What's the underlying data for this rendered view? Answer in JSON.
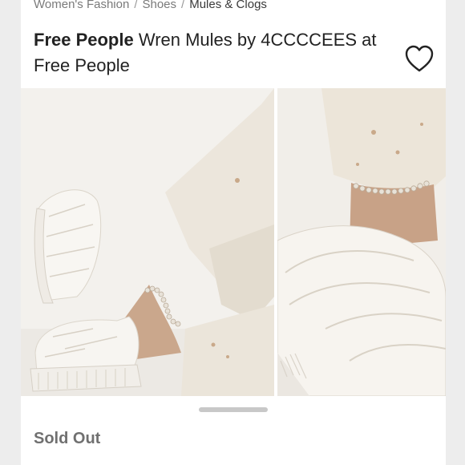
{
  "breadcrumb": {
    "items": [
      {
        "label": "Women's Fashion"
      },
      {
        "label": "Shoes"
      },
      {
        "label": "Mules & Clogs"
      }
    ],
    "separator": "/"
  },
  "listing": {
    "brand": "Free People",
    "title_rest": " Wren Mules by 4CCCCEES at Free People",
    "status": "Sold Out"
  },
  "icons": {
    "like": "heart-outline-icon"
  },
  "colors": {
    "background": "#ededed",
    "card": "#ffffff",
    "status_text": "#707070"
  }
}
